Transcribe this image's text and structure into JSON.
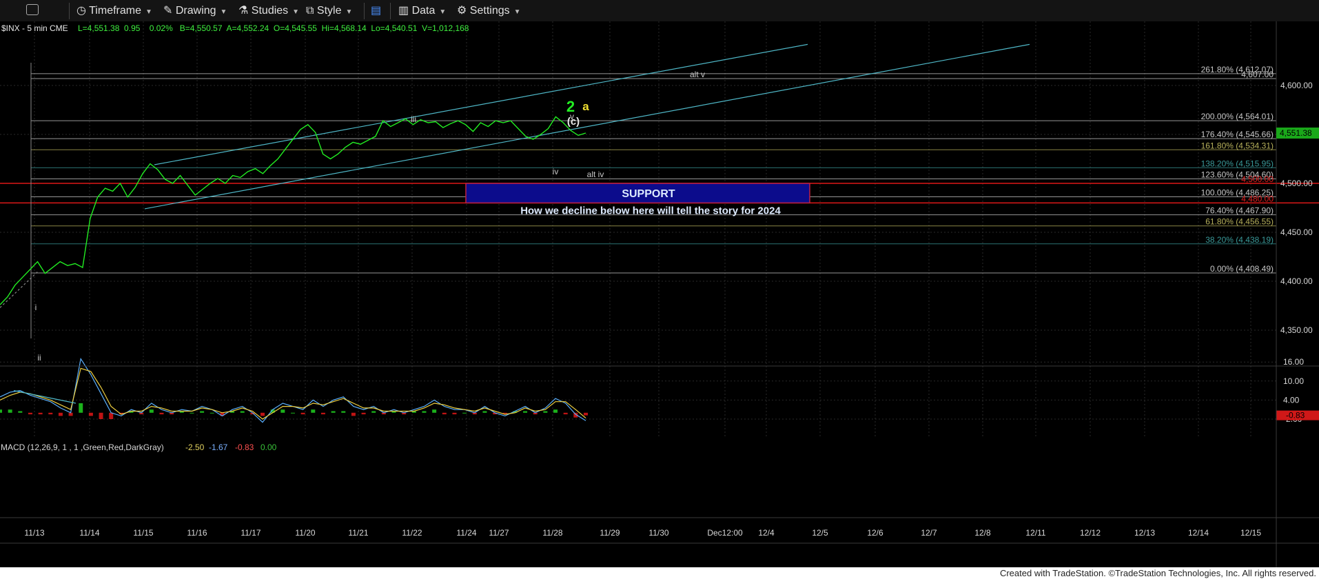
{
  "toolbar": {
    "timeframe": "Timeframe",
    "drawing": "Drawing",
    "studies": "Studies",
    "style": "Style",
    "data": "Data",
    "settings": "Settings"
  },
  "header": {
    "symbol": "$INX - 5 min  CME",
    "quote": "L=4,551.38  0.95    0.02%   B=4,550.57  A=4,552.24  O=4,545.55  Hi=4,568.14  Lo=4,540.51  V=1,012,168"
  },
  "colors": {
    "price": "#22ee22",
    "channel": "#4fb8c8",
    "fib": "#8a8a8a",
    "support_fill": "#0c0c8c",
    "support_border": "#c02040",
    "red_line": "#e01818",
    "macd_line": "#5ab0ff",
    "signal_line": "#f0d040"
  },
  "chart_data": [
    {
      "type": "line",
      "title": "$INX - 5 min",
      "ylim": [
        4300,
        4658
      ],
      "yticks": [
        "4,600.00",
        "4,550.00",
        "4,500.00",
        "4,450.00",
        "4,400.00",
        "4,350.00"
      ],
      "ytick_values": [
        4600,
        4550,
        4500,
        4450,
        4400,
        4350
      ],
      "last_price_label": "4,551.38",
      "last_price": 4551.38,
      "x_labels": [
        "11/13",
        "11/14",
        "11/15",
        "11/16",
        "11/17",
        "11/20",
        "11/21",
        "11/22",
        "11/24",
        "11/27",
        "11/28",
        "11/29",
        "11/30",
        "Dec12:00",
        "12/4",
        "12/5",
        "12/6",
        "12/7",
        "12/8",
        "12/11",
        "12/12",
        "12/13",
        "12/14",
        "12/15"
      ],
      "series": [
        {
          "values": [
            4376,
            4384,
            4396,
            4404,
            4412,
            4420,
            4408,
            4414,
            4420,
            4416,
            4418,
            4414,
            4464,
            4486,
            4495,
            4492,
            4500,
            4486,
            4496,
            4510,
            4520,
            4514,
            4504,
            4500,
            4508,
            4498,
            4488,
            4494,
            4500,
            4505,
            4500,
            4508,
            4506,
            4512,
            4515,
            4510,
            4518,
            4525,
            4535,
            4545,
            4555,
            4560,
            4552,
            4530,
            4525,
            4530,
            4537,
            4542,
            4540,
            4544,
            4548,
            4564,
            4558,
            4562,
            4566,
            4560,
            4565,
            4562,
            4563,
            4557,
            4561,
            4564,
            4560,
            4553,
            4562,
            4558,
            4564,
            4562,
            4564,
            4556,
            4548,
            4545,
            4550,
            4556,
            4568,
            4562,
            4554,
            4549,
            4551.38
          ]
        }
      ],
      "fib_levels": [
        {
          "label": "261.80% (4,612.07)",
          "value": 4612.07,
          "color": "#c8c8c8"
        },
        {
          "label": "4,607.00",
          "value": 4607,
          "color": "#c8c8c8"
        },
        {
          "label": "200.00% (4,564.01)",
          "value": 4564.01,
          "color": "#c8c8c8"
        },
        {
          "label": "176.40% (4,545.66)",
          "value": 4545.66,
          "color": "#c8c8c8"
        },
        {
          "label": "161.80% (4,534.31)",
          "value": 4534.31,
          "color": "#b8b25c"
        },
        {
          "label": "138.20% (4,515.95)",
          "value": 4515.95,
          "color": "#3a9a9a"
        },
        {
          "label": "123.60% (4,504.60)",
          "value": 4504.6,
          "color": "#c8c8c8"
        },
        {
          "label": "4,500.00",
          "value": 4500,
          "color": "#e02020"
        },
        {
          "label": "100.00% (4,486.25)",
          "value": 4486.25,
          "color": "#c8c8c8"
        },
        {
          "label": "4,480.00",
          "value": 4480,
          "color": "#e02020"
        },
        {
          "label": "76.40% (4,467.90)",
          "value": 4467.9,
          "color": "#c8c8c8"
        },
        {
          "label": "61.80% (4,456.55)",
          "value": 4456.55,
          "color": "#b8b25c"
        },
        {
          "label": "38.20% (4,438.19)",
          "value": 4438.19,
          "color": "#3a9a9a"
        },
        {
          "label": "0.00% (4,408.49)",
          "value": 4408.49,
          "color": "#c8c8c8"
        }
      ],
      "support_label": "SUPPORT",
      "note": "How we decline below here will tell the story for 2024",
      "wave_labels": [
        {
          "text": "2",
          "color": "#22ee22"
        },
        {
          "text": "a",
          "color": "#f0e030"
        },
        {
          "text": "(c)",
          "color": "#e8e8e8"
        },
        {
          "text": "iii",
          "color": "#c8c8c8"
        },
        {
          "text": "v",
          "color": "#c8c8c8"
        },
        {
          "text": "iv",
          "color": "#c8c8c8"
        },
        {
          "text": "alt iv",
          "color": "#c8c8c8"
        },
        {
          "text": "alt v",
          "color": "#c8c8c8"
        },
        {
          "text": "i",
          "color": "#c8c8c8"
        },
        {
          "text": "ii",
          "color": "#c8c8c8"
        }
      ]
    },
    {
      "type": "line",
      "title": "MACD (12,26,9, 1 , 1 ,Green,Red,DarkGray)",
      "legend_values": [
        "-2.50",
        "-1.67",
        "-0.83",
        "0.00"
      ],
      "ylim": [
        -5,
        20
      ],
      "yticks": [
        "16.00",
        "10.00",
        "4.00",
        "-2.00"
      ],
      "ytick_values": [
        16,
        10,
        4,
        -2
      ],
      "last_value_label": "-0.83",
      "last_value": -0.83,
      "series": [
        {
          "name": "MACD",
          "values": [
            5,
            6.5,
            7,
            5.5,
            4.5,
            3.5,
            1.5,
            0,
            17,
            12,
            6,
            0,
            -1,
            1,
            0,
            3,
            1,
            0,
            1,
            0.5,
            2,
            1,
            -1,
            1,
            2,
            0,
            -3,
            1,
            3,
            2,
            1,
            4,
            2,
            4,
            5,
            2,
            1,
            2,
            0,
            1,
            0,
            1,
            2,
            4,
            2,
            1,
            1,
            0,
            2,
            0,
            -1,
            0.5,
            2,
            0,
            1.5,
            4.5,
            3,
            -0.5,
            -2.5
          ]
        },
        {
          "name": "Signal",
          "values": [
            4,
            5.5,
            6.5,
            6,
            5,
            4,
            2.5,
            1,
            14,
            13,
            8,
            2,
            -0.5,
            0.5,
            0.5,
            2,
            1.5,
            0.5,
            0.5,
            0.5,
            1.5,
            1,
            0,
            0.5,
            1.5,
            0.5,
            -2,
            0,
            2,
            2,
            1.5,
            3,
            2.5,
            3.5,
            4.5,
            3,
            1.5,
            1.5,
            0.5,
            0.5,
            0.5,
            0.5,
            1.5,
            3,
            2.5,
            1.5,
            1,
            0.5,
            1.5,
            0.5,
            -0.5,
            0,
            1.5,
            0.5,
            1,
            3.5,
            3.5,
            1,
            -1.67
          ]
        }
      ]
    }
  ],
  "footer": {
    "text": "Created with TradeStation. ©TradeStation Technologies, Inc. All rights reserved."
  }
}
